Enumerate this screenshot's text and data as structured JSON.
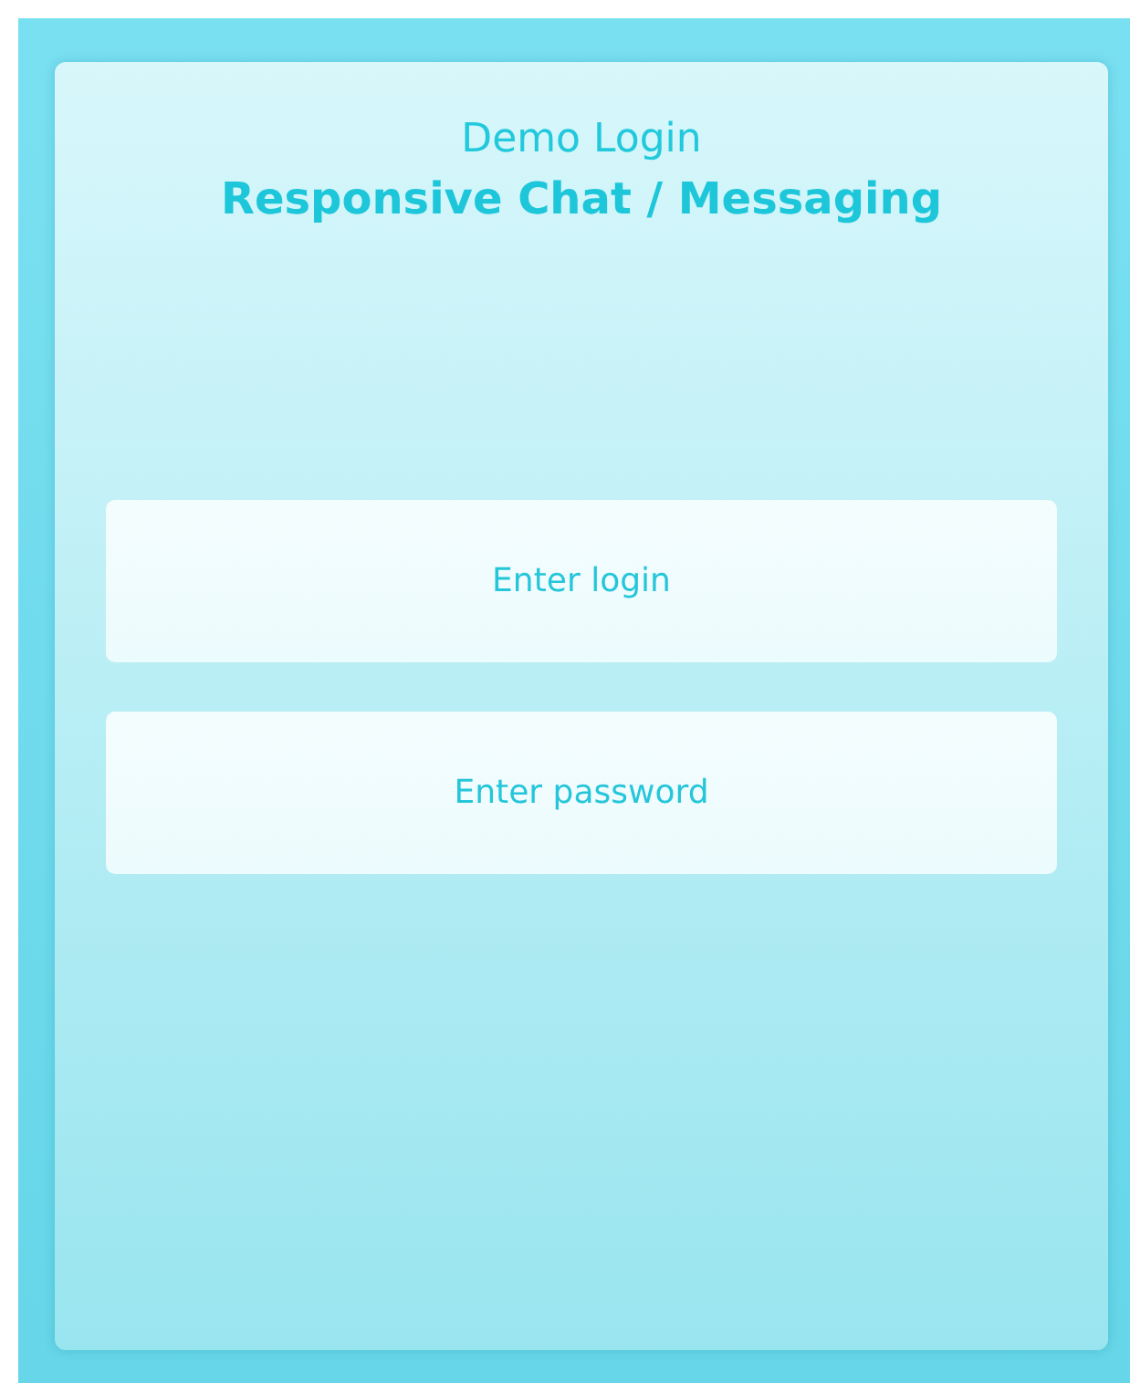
{
  "header": {
    "title": "Demo Login",
    "subtitle": "Responsive Chat / Messaging"
  },
  "fields": [
    {
      "placeholder": "Enter login"
    },
    {
      "placeholder": "Enter password"
    }
  ]
}
